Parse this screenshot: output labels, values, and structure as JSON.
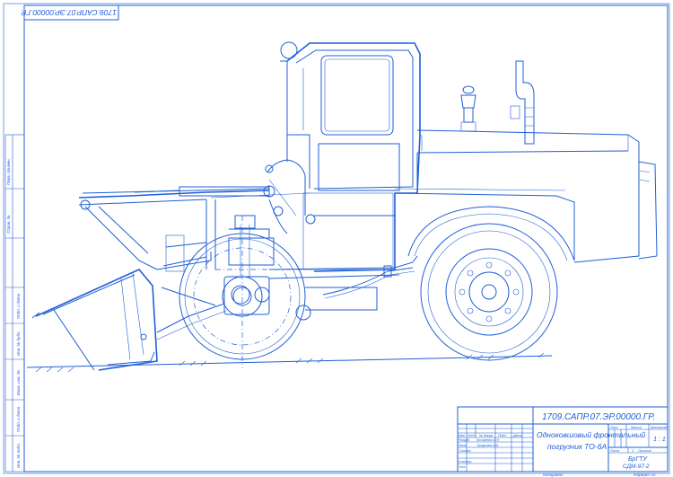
{
  "colors": {
    "paper": "#ffffff",
    "line": "#1f5fd6"
  },
  "corner_stamp": "1709.САПР.07.ЭР.00000.ГР.",
  "title_block": {
    "designation": "1709.САПР.07.ЭР.00000.ГР.",
    "title_line1": "Одноковшовый фронтальный",
    "title_line2": "погрузчик ТО-6А",
    "header_lit": "Лит.",
    "header_mass": "Масса",
    "header_scale": "Масштаб",
    "scale_value": "1:1",
    "sheet_label": "Лист",
    "sheets_label": "Листов",
    "sheets_value": "1",
    "org_line1": "БрГТУ",
    "org_line2": "СДМ-97-2",
    "left_col_headers": [
      "Изм.",
      "Лист",
      "№ докум.",
      "Подп.",
      "Дата"
    ],
    "rows": [
      {
        "role": "Разраб.",
        "name": "Косименко В.Ф."
      },
      {
        "role": "Пров.",
        "name": "Трофимов А.А."
      },
      {
        "role": "Т.контр.",
        "name": ""
      },
      {
        "role": "Н.контр.",
        "name": ""
      },
      {
        "role": "Утв.",
        "name": ""
      }
    ]
  },
  "margin_labels": [
    "Перв. примен.",
    "Справ. №",
    "Подп. и дата",
    "Инв. № дубл.",
    "Взам. инв. №",
    "Подп. и дата",
    "Инв. № подл."
  ],
  "footer": {
    "copied": "Копировал",
    "format": "Формат А2"
  }
}
